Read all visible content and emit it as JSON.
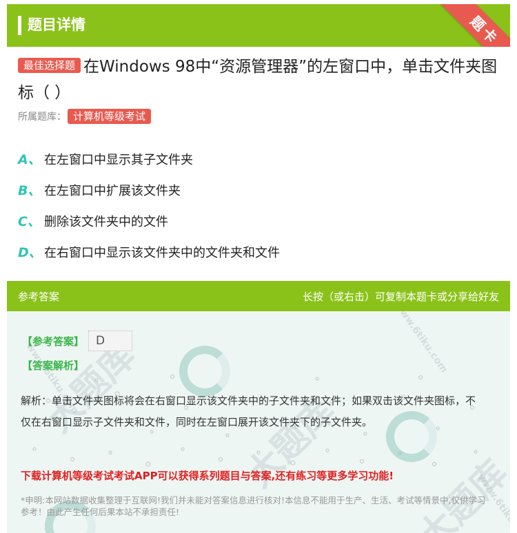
{
  "header": {
    "title": "题目详情",
    "corner_badge": "题卡"
  },
  "question": {
    "type_tag": "最佳选择题",
    "text": "在Windows 98中“资源管理器”的左窗口中，单击文件夹图标（ ）",
    "source_label": "所属题库：",
    "source_tag": "计算机等级考试"
  },
  "options": [
    {
      "letter": "A、",
      "text": "在左窗口中显示其子文件夹"
    },
    {
      "letter": "B、",
      "text": "在左窗口中扩展该文件夹"
    },
    {
      "letter": "C、",
      "text": "删除该文件夹中的文件"
    },
    {
      "letter": "D、",
      "text": "在右窗口中显示该文件夹中的文件夹和文件"
    }
  ],
  "answer_bar": {
    "left": "参考答案",
    "right": "长按（或右击）可复制本题卡或分享给好友"
  },
  "answer": {
    "ref_label": "【参考答案】",
    "ref_value": "D",
    "analysis_label": "【答案解析】",
    "analysis_text": "解析：单击文件夹图标将会在右窗口显示该文件夹中的子文件夹和文件；如果双击该文件夹图标，不仅在右窗口显示子文件夹和文件，同时在左窗口展开该文件夹下的子文件夹。",
    "promo": "下载计算机等级考试考试APP可以获得系列题目与答案,还有练习等更多学习功能!",
    "disclaimer": "*申明:本网站数据收集整理于互联网!我们并未能对答案信息进行核对!本信息不能用于生产、生活、考试等情景中,仅供学习参考！由此产生任何后果本站不承担责任!"
  },
  "watermark": {
    "text": "大题库",
    "url": "www.6tiku.com"
  },
  "colors": {
    "green": "#8bc21a",
    "red": "#e85a4f",
    "teal": "#2ec4b6",
    "answer_green": "#3bb54a",
    "promo_red": "#e02020"
  }
}
